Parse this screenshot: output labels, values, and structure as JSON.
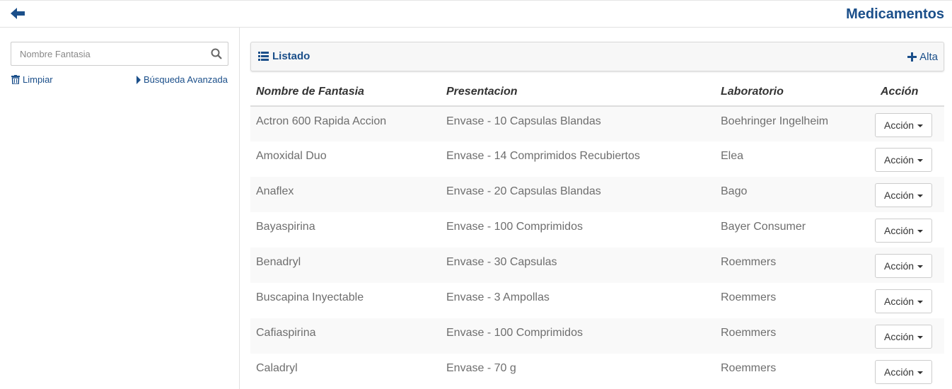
{
  "header": {
    "title": "Medicamentos"
  },
  "sidebar": {
    "search": {
      "placeholder": "Nombre Fantasia",
      "value": ""
    },
    "clear_label": "Limpiar",
    "advanced_label": "Búsqueda Avanzada"
  },
  "panel": {
    "title": "Listado",
    "add_label": "Alta"
  },
  "table": {
    "columns": [
      "Nombre de Fantasia",
      "Presentacion",
      "Laboratorio",
      "Acción"
    ],
    "rows": [
      {
        "name": "Actron 600 Rapida Accion",
        "presentation": "Envase - 10 Capsulas Blandas",
        "lab": "Boehringer Ingelheim",
        "action": "Acción"
      },
      {
        "name": "Amoxidal Duo",
        "presentation": "Envase - 14 Comprimidos Recubiertos",
        "lab": "Elea",
        "action": "Acción"
      },
      {
        "name": "Anaflex",
        "presentation": "Envase - 20 Capsulas Blandas",
        "lab": "Bago",
        "action": "Acción"
      },
      {
        "name": "Bayaspirina",
        "presentation": "Envase - 100 Comprimidos",
        "lab": "Bayer Consumer",
        "action": "Acción"
      },
      {
        "name": "Benadryl",
        "presentation": "Envase - 30 Capsulas",
        "lab": "Roemmers",
        "action": "Acción"
      },
      {
        "name": "Buscapina Inyectable",
        "presentation": "Envase - 3 Ampollas",
        "lab": "Roemmers",
        "action": "Acción"
      },
      {
        "name": "Cafiaspirina",
        "presentation": "Envase - 100 Comprimidos",
        "lab": "Roemmers",
        "action": "Acción"
      },
      {
        "name": "Caladryl",
        "presentation": "Envase - 70 g",
        "lab": "Roemmers",
        "action": "Acción"
      }
    ]
  },
  "colors": {
    "accent": "#1b4f8a",
    "text_muted": "#6e6e6e",
    "row_striped": "#f9f9f9"
  },
  "icons": {
    "back": "arrow-left-icon",
    "search": "search-icon",
    "clear": "trash-icon",
    "advanced": "caret-right-icon",
    "list": "list-icon",
    "add": "plus-icon",
    "dropdown": "caret-down-icon"
  }
}
